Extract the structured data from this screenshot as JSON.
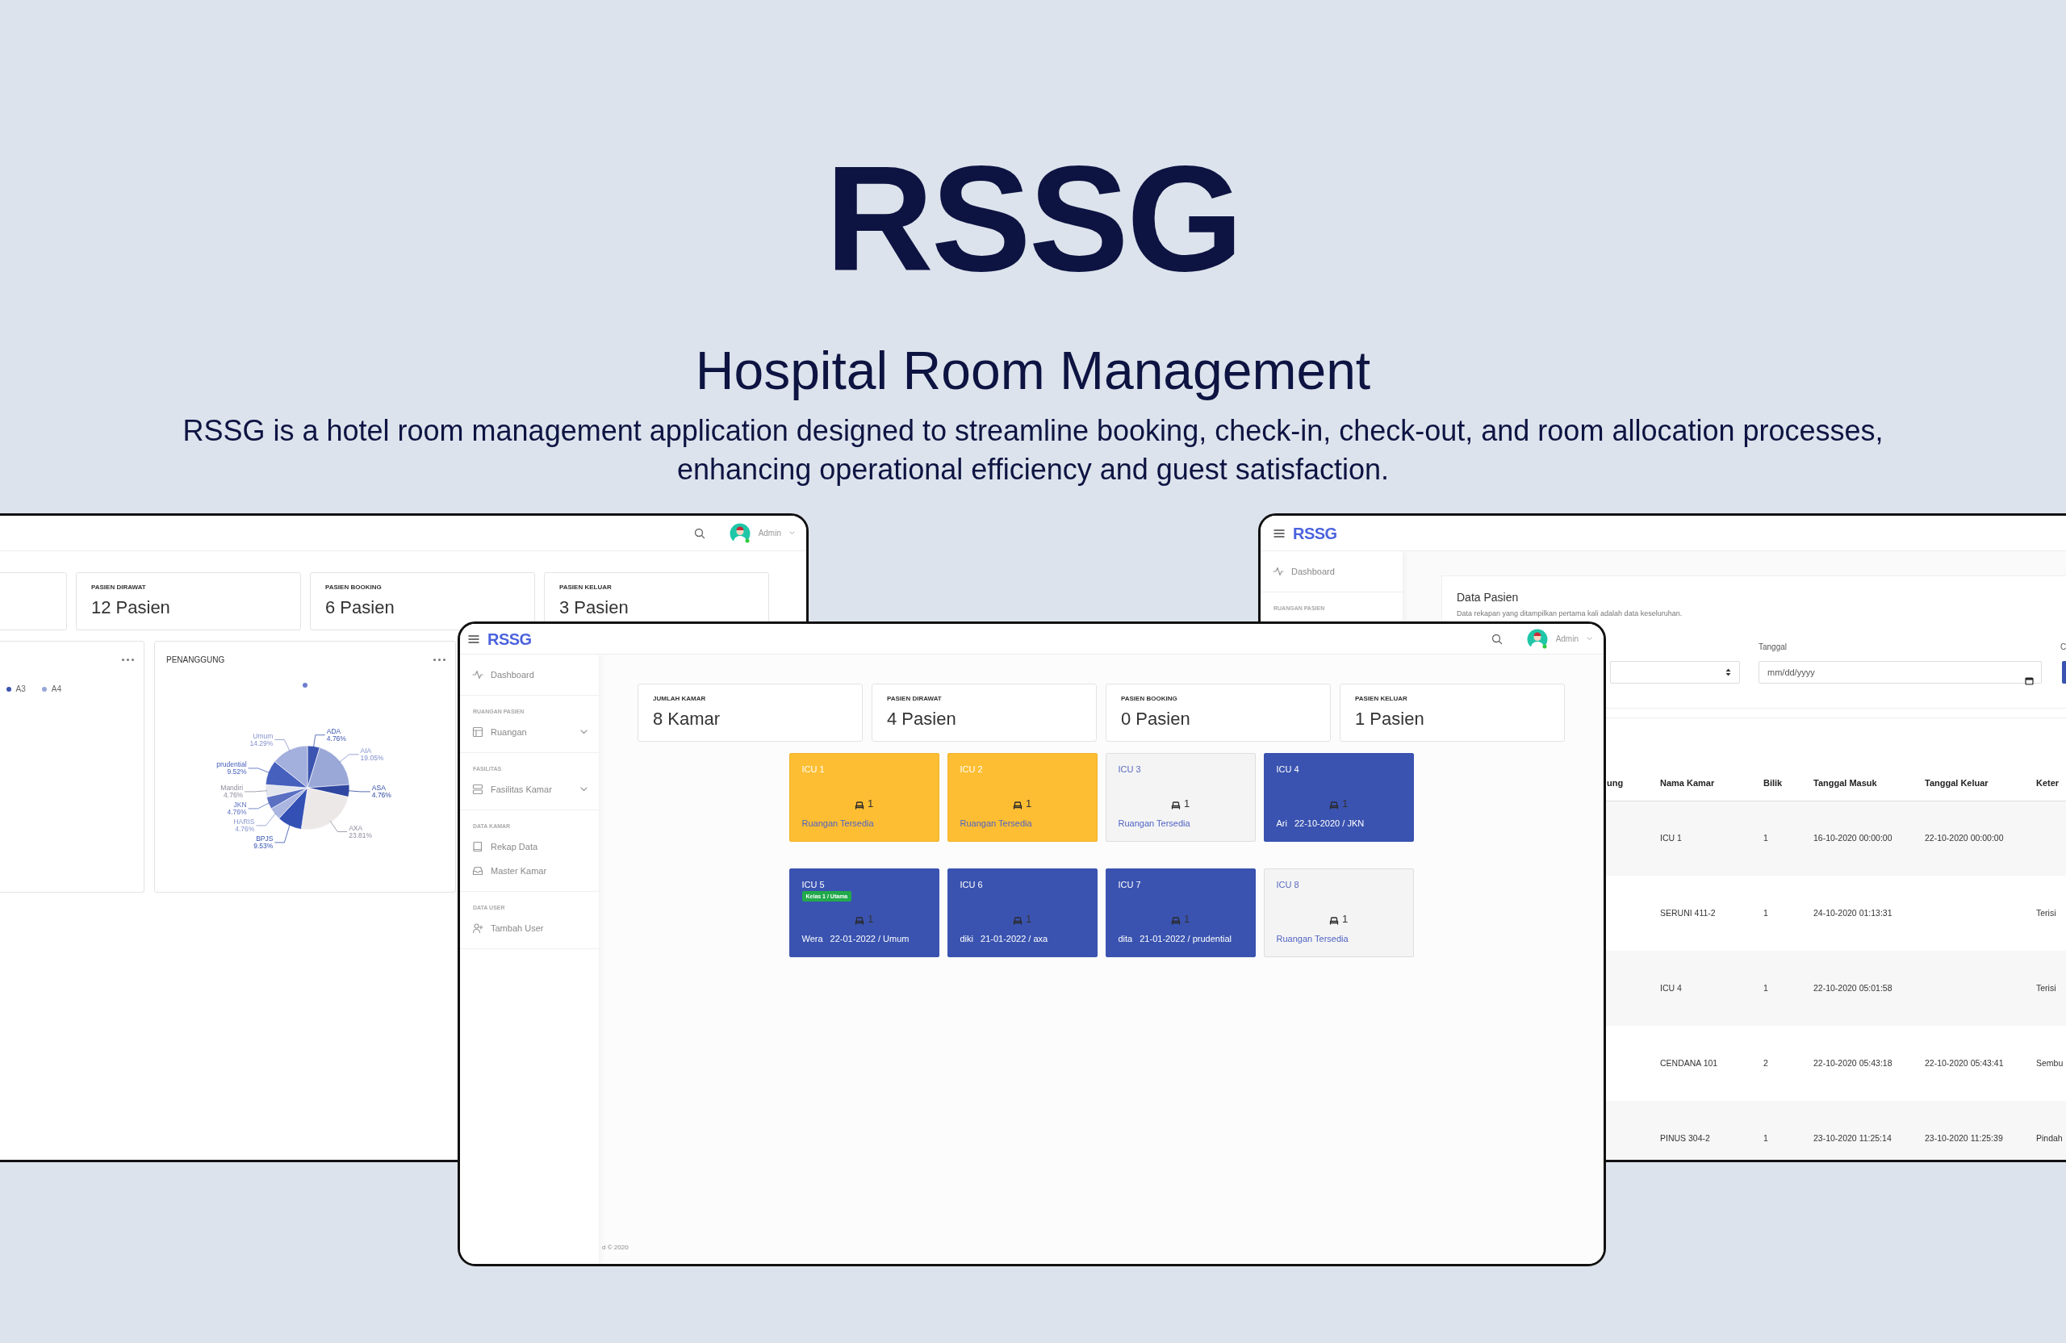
{
  "hero": {
    "title": "RSSG",
    "subtitle": "Hospital Room Management",
    "description": "RSSG is a hotel room management application designed to streamline booking, check-in, check-out, and room allocation processes, enhancing operational efficiency and guest satisfaction."
  },
  "left_window": {
    "user": "Admin",
    "stats": [
      {
        "label": "PASIEN DIRAWAT",
        "value": "12 Pasien"
      },
      {
        "label": "PASIEN BOOKING",
        "value": "6 Pasien"
      },
      {
        "label": "PASIEN KELUAR",
        "value": "3 Pasien"
      }
    ],
    "legend_card": {
      "legend": [
        {
          "label": "A3",
          "color": "#3b55b0"
        },
        {
          "label": "A4",
          "color": "#98a6d6"
        }
      ]
    },
    "chart_card": {
      "chart_data": {
        "type": "pie",
        "title": "PENANGGUNG",
        "categories": [
          "ADA",
          "AIA",
          "ASA",
          "AXA",
          "BPJS",
          "HARIS",
          "JKN",
          "Mandiri",
          "prudential",
          "Umum"
        ],
        "values": [
          4.76,
          19.05,
          4.76,
          23.81,
          9.53,
          4.76,
          4.76,
          4.76,
          9.52,
          14.29
        ],
        "data_labels": true,
        "value_labels": [
          "4.76%",
          "19.05%",
          "4.76%",
          "23.81%",
          "9.53%",
          "4.76%",
          "4.76%",
          "4.76%",
          "9.52%",
          "14.29%"
        ]
      }
    }
  },
  "right_window": {
    "logo": "RSSG",
    "sidebar": [
      {
        "items": [
          {
            "label": "Dashboard",
            "expandable": false
          }
        ]
      },
      {
        "heading": "RUANGAN PASIEN"
      }
    ],
    "panel": {
      "title": "Data Pasien",
      "subtitle": "Data rekapan yang ditampilkan pertama kali adalah data keseluruhan.",
      "date_field": {
        "label": "Tanggal",
        "placeholder": "mm/dd/yyyy"
      },
      "column_3_label": "C"
    },
    "table": {
      "columns": [
        "ung",
        "Nama Kamar",
        "Bilik",
        "Tanggal Masuk",
        "Tanggal Keluar",
        "Keter"
      ],
      "rows": [
        {
          "cells": [
            "",
            "ICU 1",
            "1",
            "16-10-2020 00:00:00",
            "22-10-2020 00:00:00",
            ""
          ]
        },
        {
          "cells": [
            "",
            "SERUNI 411-2",
            "1",
            "24-10-2020 01:13:31",
            "",
            "Terisi"
          ]
        },
        {
          "cells": [
            "",
            "ICU 4",
            "1",
            "22-10-2020 05:01:58",
            "",
            "Terisi"
          ]
        },
        {
          "cells": [
            "",
            "CENDANA 101",
            "2",
            "22-10-2020 05:43:18",
            "22-10-2020 05:43:41",
            "Sembu"
          ]
        },
        {
          "cells": [
            "",
            "PINUS 304-2",
            "1",
            "23-10-2020 11:25:14",
            "23-10-2020 11:25:39",
            "Pindah"
          ]
        }
      ]
    }
  },
  "main_window": {
    "logo": "RSSG",
    "user": "Admin",
    "sidebar": [
      {
        "items": [
          {
            "label": "Dashboard",
            "expandable": false
          }
        ]
      },
      {
        "heading": "RUANGAN PASIEN",
        "items": [
          {
            "label": "Ruangan",
            "expandable": true
          }
        ]
      },
      {
        "heading": "FASILITAS",
        "items": [
          {
            "label": "Fasilitas Kamar",
            "expandable": true
          }
        ]
      },
      {
        "heading": "DATA KAMAR",
        "items": [
          {
            "label": "Rekap Data",
            "expandable": false
          },
          {
            "label": "Master Kamar",
            "expandable": false
          }
        ]
      },
      {
        "heading": "DATA USER",
        "items": [
          {
            "label": "Tambah User",
            "expandable": false
          }
        ]
      }
    ],
    "stats": [
      {
        "label": "JUMLAH KAMAR",
        "value": "8 Kamar"
      },
      {
        "label": "PASIEN DIRAWAT",
        "value": "4 Pasien"
      },
      {
        "label": "PASIEN BOOKING",
        "value": "0 Pasien"
      },
      {
        "label": "PASIEN KELUAR",
        "value": "1 Pasien"
      }
    ],
    "rooms": [
      {
        "name": "ICU 1",
        "kind": "reserved",
        "beds": "1",
        "status": "Ruangan Tersedia"
      },
      {
        "name": "ICU 2",
        "kind": "reserved",
        "beds": "1",
        "status": "Ruangan Tersedia"
      },
      {
        "name": "ICU 3",
        "kind": "vacant",
        "beds": "1",
        "status": "Ruangan Tersedia"
      },
      {
        "name": "ICU 4",
        "kind": "occupied",
        "beds": "1",
        "patient": "Ari",
        "detail": "22-10-2020 / JKN"
      },
      {
        "name": "ICU 5",
        "kind": "occupied",
        "badge": "Kelas 1 / Utama",
        "beds": "1",
        "patient": "Wera",
        "detail": "22-01-2022 / Umum"
      },
      {
        "name": "ICU 6",
        "kind": "occupied",
        "beds": "1",
        "patient": "diki",
        "detail": "21-01-2022 / axa"
      },
      {
        "name": "ICU 7",
        "kind": "occupied",
        "beds": "1",
        "patient": "dita",
        "detail": "21-01-2022 / prudential"
      },
      {
        "name": "ICU 8",
        "kind": "vacant",
        "beds": "1",
        "status": "Ruangan Tersedia"
      }
    ],
    "footer": "d © 2020"
  }
}
